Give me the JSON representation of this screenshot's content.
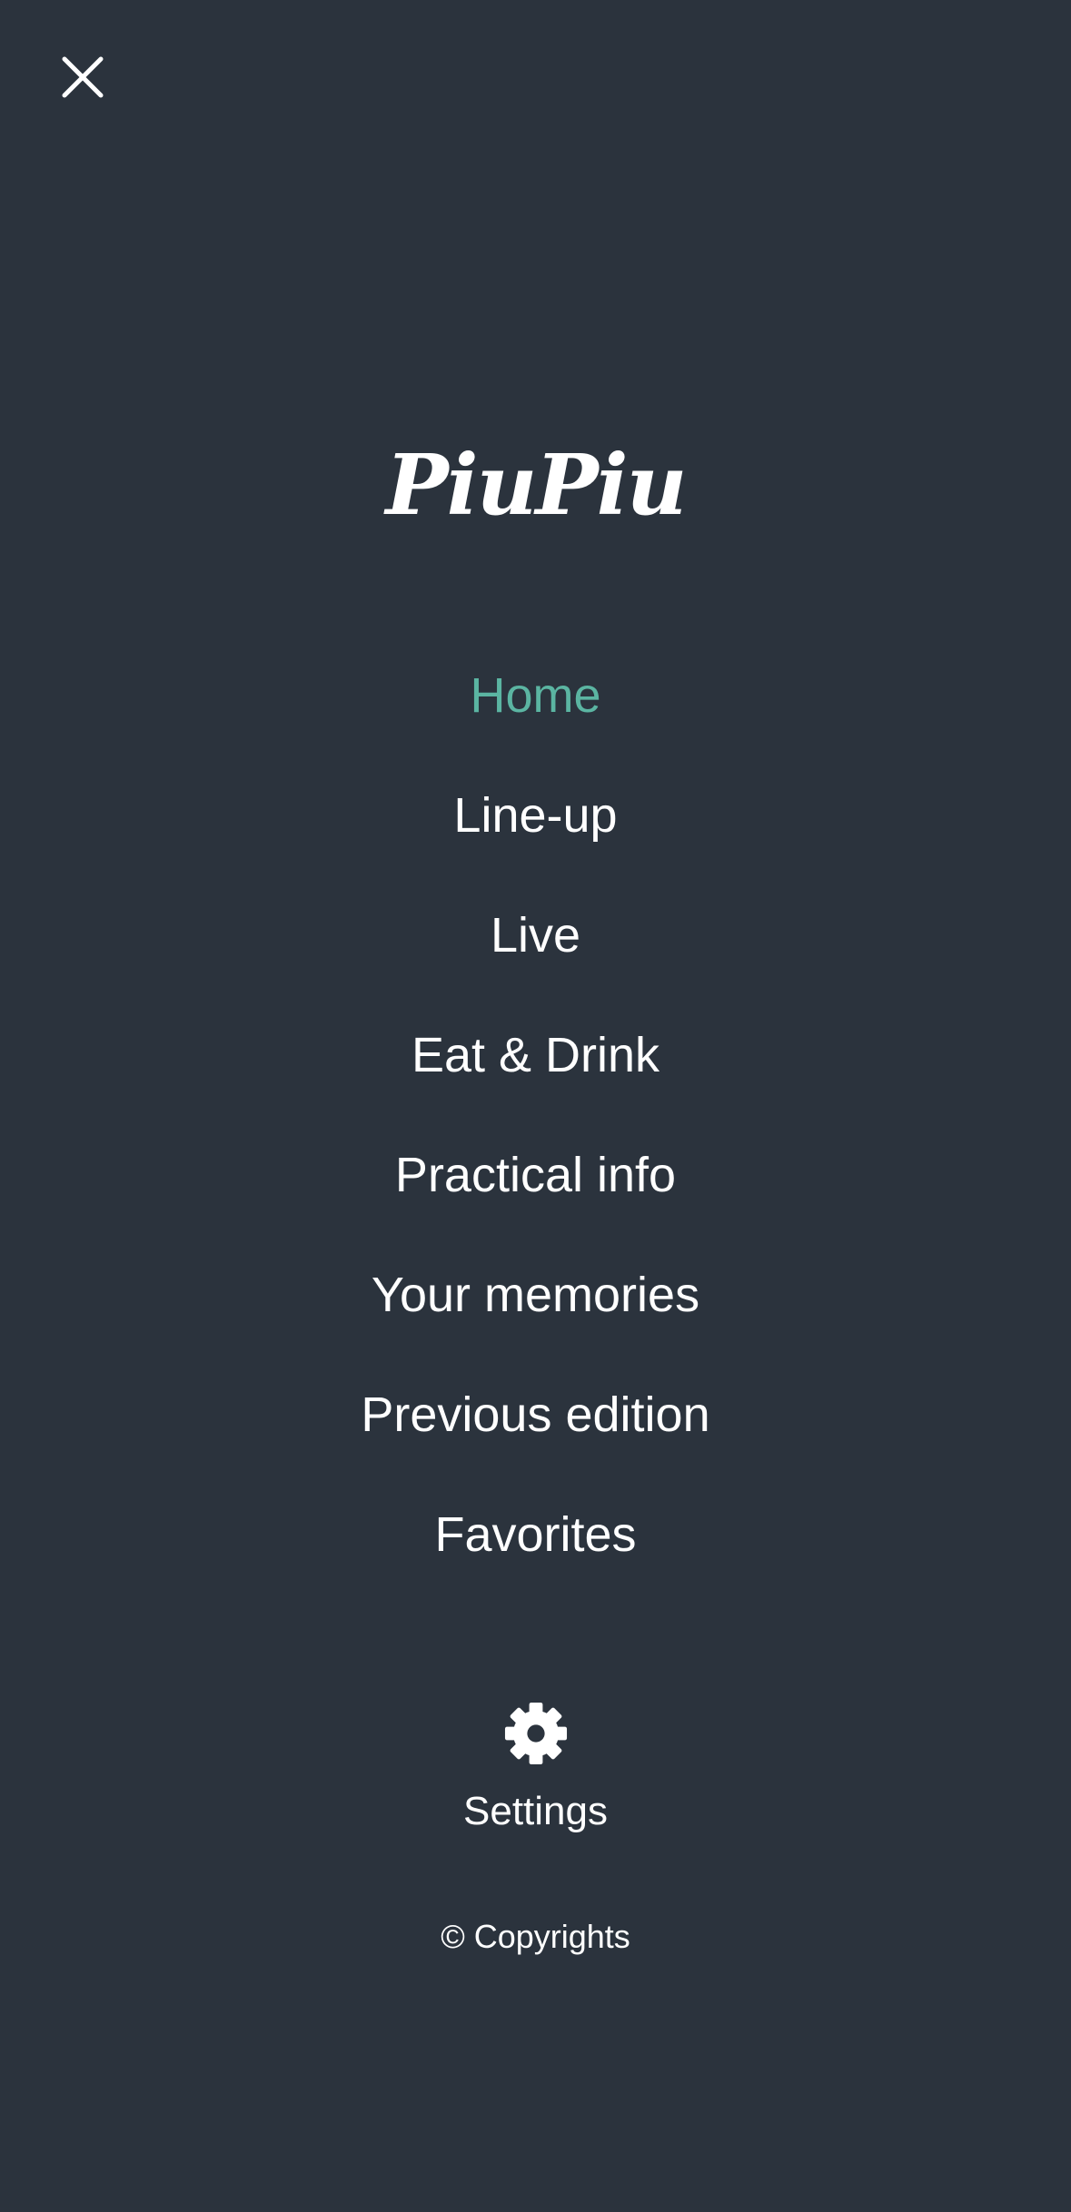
{
  "menu": {
    "close_icon": "close-icon",
    "logo_text": "PiuPiu",
    "items": [
      {
        "label": "Home",
        "active": true
      },
      {
        "label": "Line-up",
        "active": false
      },
      {
        "label": "Live",
        "active": false
      },
      {
        "label": "Eat & Drink",
        "active": false
      },
      {
        "label": "Practical info",
        "active": false
      },
      {
        "label": "Your memories",
        "active": false
      },
      {
        "label": "Previous edition",
        "active": false
      },
      {
        "label": "Favorites",
        "active": false
      }
    ],
    "settings": {
      "icon": "gear-icon",
      "label": "Settings"
    },
    "copyright": "© Copyrights"
  },
  "colors": {
    "background": "#2b333d",
    "text": "#ffffff",
    "accent": "#5bb5a2"
  }
}
